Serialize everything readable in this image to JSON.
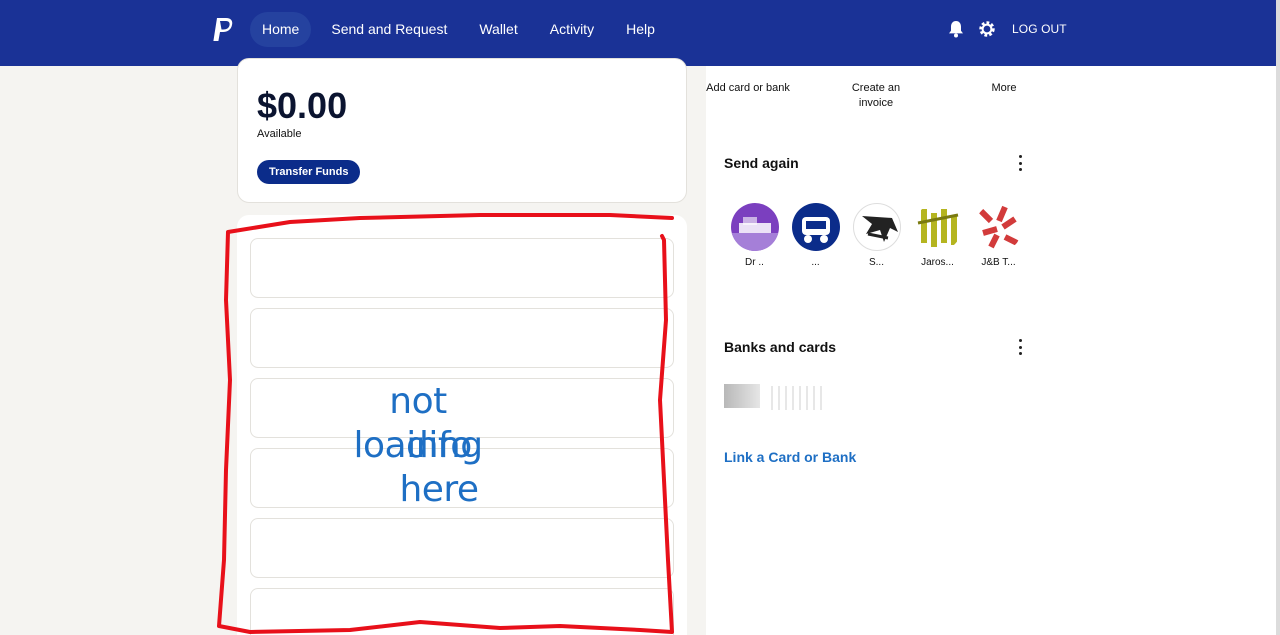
{
  "header": {
    "logo_icon": "paypal-logo",
    "nav": [
      {
        "label": "Home",
        "active": true
      },
      {
        "label": "Send and Request",
        "active": false
      },
      {
        "label": "Wallet",
        "active": false
      },
      {
        "label": "Activity",
        "active": false
      },
      {
        "label": "Help",
        "active": false
      }
    ],
    "icons": [
      "bell-icon",
      "gear-icon"
    ],
    "logout_label": "LOG OUT",
    "bg_color": "#1a3296"
  },
  "balance": {
    "amount": "$0.00",
    "sub": "Available",
    "transfer_label": "Transfer Funds"
  },
  "activity": {
    "placeholder_rows": 6
  },
  "annotation": {
    "line1": "not loading",
    "line2": "info here",
    "color": "#e8101a"
  },
  "quick_actions": [
    {
      "label": "Add card or bank"
    },
    {
      "label": "Create an invoice"
    },
    {
      "label": "More"
    }
  ],
  "send_again": {
    "title": "Send again",
    "contacts": [
      {
        "name": "Dr ..",
        "color": "#7b3fbf"
      },
      {
        "name": "...",
        "color": "#0b2c8a"
      },
      {
        "name": "S...",
        "color": "#222222"
      },
      {
        "name": "Jaros...",
        "color": "#b5b520"
      },
      {
        "name": "J&B T...",
        "color": "#d23b3b"
      }
    ]
  },
  "banks": {
    "title": "Banks and cards",
    "link_label": "Link a Card or Bank"
  }
}
